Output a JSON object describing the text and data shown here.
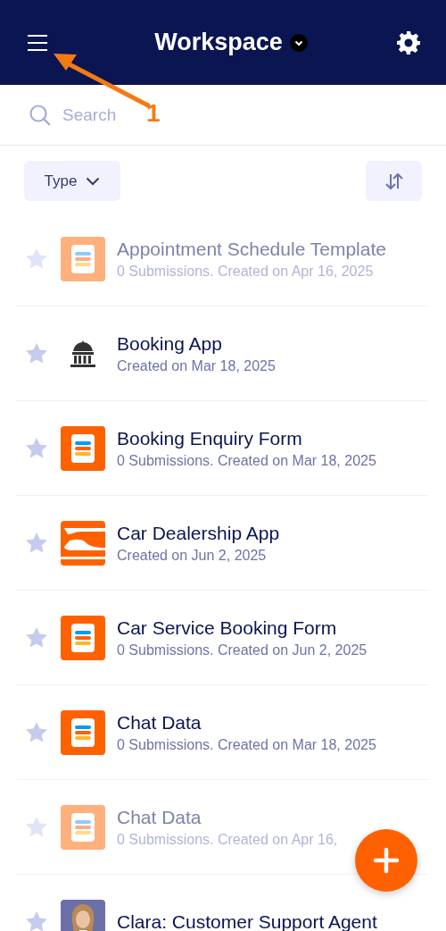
{
  "header": {
    "title": "Workspace"
  },
  "annotation": {
    "label": "1"
  },
  "search": {
    "placeholder": "Search"
  },
  "filter": {
    "label": "Type"
  },
  "items": [
    {
      "kind": "form",
      "title": "Appointment Schedule Template",
      "subtitle": "0 Submissions. Created on Apr 16, 2025",
      "dimmed": true
    },
    {
      "kind": "building-app",
      "title": "Booking App",
      "subtitle": "Created on Mar 18, 2025",
      "dimmed": false
    },
    {
      "kind": "form",
      "title": "Booking Enquiry Form",
      "subtitle": "0 Submissions. Created on Mar 18, 2025",
      "dimmed": false
    },
    {
      "kind": "car-app",
      "title": "Car Dealership App",
      "subtitle": "Created on Jun 2, 2025",
      "dimmed": false
    },
    {
      "kind": "form",
      "title": "Car Service Booking Form",
      "subtitle": "0 Submissions. Created on Jun 2, 2025",
      "dimmed": false
    },
    {
      "kind": "form",
      "title": "Chat Data",
      "subtitle": "0 Submissions. Created on Mar 18, 2025",
      "dimmed": false
    },
    {
      "kind": "form",
      "title": "Chat Data",
      "subtitle": "0 Submissions. Created on Apr 16,",
      "dimmed": true
    },
    {
      "kind": "agent",
      "title": "Clara: Customer Support Agent",
      "dimmed": false
    }
  ]
}
